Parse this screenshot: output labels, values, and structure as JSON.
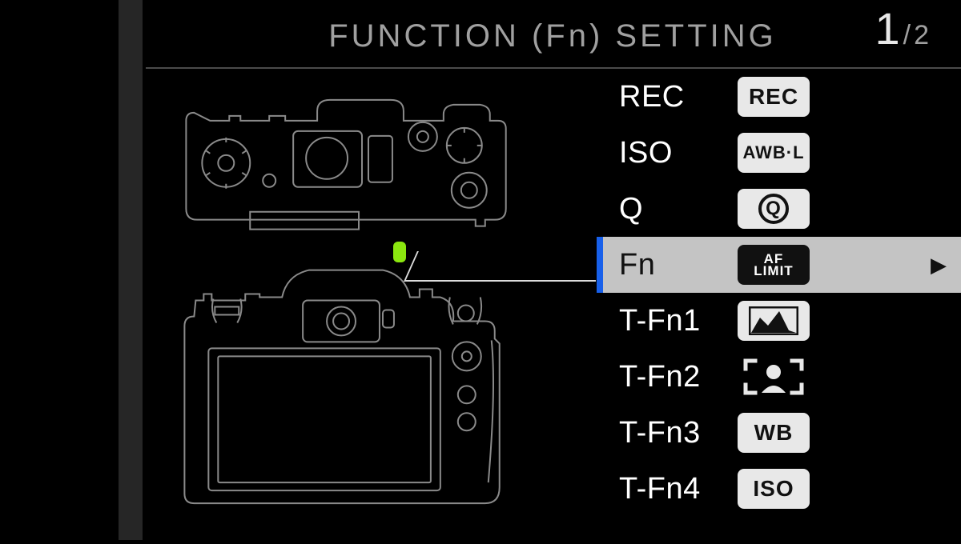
{
  "header": {
    "title": "FUNCTION (Fn) SETTING",
    "page_current": "1",
    "page_sep": "/",
    "page_total": "2"
  },
  "selected_index": 3,
  "menu": [
    {
      "label": "REC",
      "badge_text": "REC",
      "badge_style": "light"
    },
    {
      "label": "ISO",
      "badge_text": "AWB·L",
      "badge_style": "light"
    },
    {
      "label": "Q",
      "badge_text": "Q",
      "badge_style": "q"
    },
    {
      "label": "Fn",
      "badge_text_top": "AF",
      "badge_text_bottom": "LIMIT",
      "badge_style": "stack"
    },
    {
      "label": "T-Fn1",
      "badge_style": "histogram"
    },
    {
      "label": "T-Fn2",
      "badge_style": "face"
    },
    {
      "label": "T-Fn3",
      "badge_text": "WB",
      "badge_style": "light"
    },
    {
      "label": "T-Fn4",
      "badge_text": "ISO",
      "badge_style": "light-iso"
    }
  ],
  "arrow": "▶",
  "colors": {
    "highlight": "#8be60f",
    "sel_bg": "#c4c4c4",
    "sel_accent": "#1860ea"
  }
}
